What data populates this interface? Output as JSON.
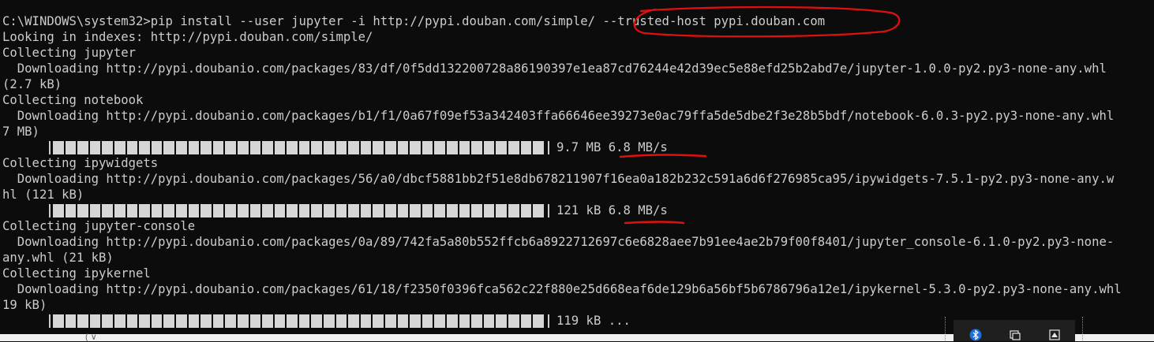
{
  "terminal": {
    "lines": [
      {
        "kind": "text",
        "text": "C:\\WINDOWS\\system32>pip install --user jupyter -i http://pypi.douban.com/simple/ --trusted-host pypi.douban.com"
      },
      {
        "kind": "text",
        "text": "Looking in indexes: http://pypi.douban.com/simple/"
      },
      {
        "kind": "text",
        "text": "Collecting jupyter"
      },
      {
        "kind": "text",
        "text": "  Downloading http://pypi.doubanio.com/packages/83/df/0f5dd132200728a86190397e1ea87cd76244e42d39ec5e88efd25b2abd7e/jupyter-1.0.0-py2.py3-none-any.whl"
      },
      {
        "kind": "text",
        "text": "(2.7 kB)"
      },
      {
        "kind": "text",
        "text": "Collecting notebook"
      },
      {
        "kind": "text",
        "text": "  Downloading http://pypi.doubanio.com/packages/b1/f1/0a67f09ef53a342403ffa66646ee39273e0ac79ffa5de5dbe2f3e28b5bdf/notebook-6.0.3-py2.py3-none-any.whl"
      },
      {
        "kind": "text",
        "text": "7 MB)"
      },
      {
        "kind": "bar",
        "progress": 1.0,
        "text": "9.7 MB 6.8 MB/s"
      },
      {
        "kind": "text",
        "text": "Collecting ipywidgets"
      },
      {
        "kind": "text",
        "text": "  Downloading http://pypi.doubanio.com/packages/56/a0/dbcf5881bb2f51e8db678211907f16ea0a182b232c591a6d6f276985ca95/ipywidgets-7.5.1-py2.py3-none-any.w"
      },
      {
        "kind": "text",
        "text": "hl (121 kB)"
      },
      {
        "kind": "bar",
        "progress": 1.0,
        "text": "121 kB 6.8 MB/s"
      },
      {
        "kind": "text",
        "text": "Collecting jupyter-console"
      },
      {
        "kind": "text",
        "text": "  Downloading http://pypi.doubanio.com/packages/0a/89/742fa5a80b552ffcb6a8922712697c6e6828aee7b91ee4ae2b79f00f8401/jupyter_console-6.1.0-py2.py3-none-"
      },
      {
        "kind": "text",
        "text": "any.whl (21 kB)"
      },
      {
        "kind": "text",
        "text": "Collecting ipykernel"
      },
      {
        "kind": "text",
        "text": "  Downloading http://pypi.doubanio.com/packages/61/18/f2350f0396fca562c22f880e25d668eaf6de129b6a56bf5b6786796a12e1/ipykernel-5.3.0-py2.py3-none-any.whl"
      },
      {
        "kind": "text",
        "text": "19 kB)"
      },
      {
        "kind": "bar",
        "progress": 1.0,
        "text": "119 kB ..."
      }
    ]
  },
  "colors": {
    "background": "#0c0c0c",
    "foreground": "#cccccc",
    "annotation": "#e01010"
  },
  "icons": [
    "bluetooth-icon",
    "window-icon",
    "network-icon"
  ]
}
